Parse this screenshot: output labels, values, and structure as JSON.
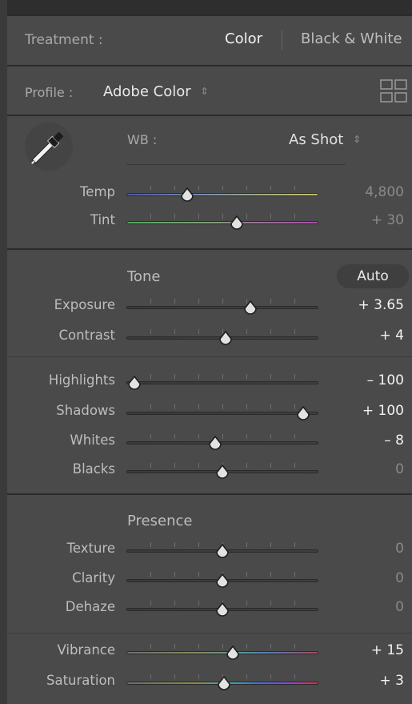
{
  "treatment": {
    "label": "Treatment :",
    "color": "Color",
    "bw": "Black & White"
  },
  "profile": {
    "label": "Profile :",
    "value": "Adobe Color"
  },
  "wb": {
    "label": "WB :",
    "value": "As Shot"
  },
  "icons": {
    "eyedropper": "eyedropper-icon",
    "grid": "grid-icon",
    "stepper": "up-down-chevron-icon",
    "thumb": "slider-thumb-icon"
  },
  "wb_sliders": [
    {
      "label": "Temp",
      "value": "4,800",
      "pos": 0.3,
      "track": "temp",
      "dim": true
    },
    {
      "label": "Tint",
      "value": "+ 30",
      "pos": 0.58,
      "track": "tint",
      "dim": true
    }
  ],
  "tone": {
    "title": "Tone",
    "auto": "Auto"
  },
  "tone_sliders": [
    {
      "label": "Exposure",
      "value": "+ 3.65",
      "pos": 0.66,
      "track": "gray",
      "dim": false
    },
    {
      "label": "Contrast",
      "value": "+ 4",
      "pos": 0.52,
      "track": "gray",
      "dim": false
    }
  ],
  "tone2_sliders": [
    {
      "label": "Highlights",
      "value": "– 100",
      "pos": 0.0,
      "track": "gray",
      "dim": false
    },
    {
      "label": "Shadows",
      "value": "+ 100",
      "pos": 0.96,
      "track": "gray",
      "dim": false
    },
    {
      "label": "Whites",
      "value": "– 8",
      "pos": 0.46,
      "track": "gray",
      "dim": false
    },
    {
      "label": "Blacks",
      "value": "0",
      "pos": 0.5,
      "track": "gray",
      "dim": true
    }
  ],
  "presence": {
    "title": "Presence"
  },
  "presence_sliders": [
    {
      "label": "Texture",
      "value": "0",
      "pos": 0.5,
      "track": "gray",
      "dim": true
    },
    {
      "label": "Clarity",
      "value": "0",
      "pos": 0.5,
      "track": "gray",
      "dim": true
    },
    {
      "label": "Dehaze",
      "value": "0",
      "pos": 0.5,
      "track": "gray",
      "dim": true
    }
  ],
  "color_sliders": [
    {
      "label": "Vibrance",
      "value": "+ 15",
      "pos": 0.56,
      "track": "vibrance",
      "dim": false
    },
    {
      "label": "Saturation",
      "value": "+ 3",
      "pos": 0.51,
      "track": "saturation",
      "dim": false
    }
  ],
  "colors": {
    "temp_track": "#4a59c7 → #c4c046",
    "tint_track": "#3fbf4a → #c838c2",
    "panel_bg": "#4a4a4a",
    "divider": "#2b2b2b"
  }
}
